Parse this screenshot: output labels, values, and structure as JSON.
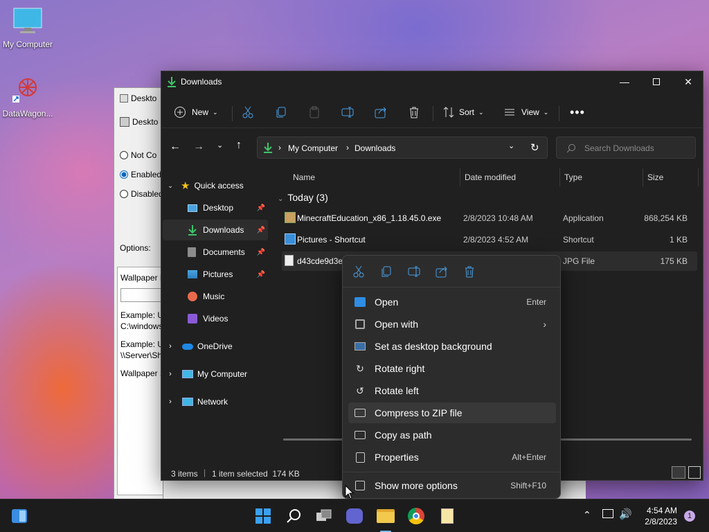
{
  "desktop": {
    "icons": [
      {
        "label": "My Computer"
      },
      {
        "label": "DataWagon..."
      }
    ]
  },
  "background_window": {
    "title": "Deskto",
    "header": "Deskto",
    "radio_not": "Not Co",
    "radio_enabled": "Enabled",
    "radio_disabled": "Disabled",
    "options_label": "Options:",
    "field_label": "Wallpaper N",
    "example1a": "Example: U",
    "example1b": "C:\\windows",
    "example2a": "Example: U",
    "example2b": "\\\\Server\\Sh",
    "style_label": "Wallpaper S"
  },
  "explorer": {
    "title": "Downloads",
    "toolbar": {
      "new_label": "New",
      "sort_label": "Sort",
      "view_label": "View"
    },
    "address": {
      "segments": [
        "My Computer",
        "Downloads"
      ]
    },
    "search": {
      "placeholder": "Search Downloads"
    },
    "nav": {
      "quick_access": "Quick access",
      "items": [
        {
          "label": "Desktop"
        },
        {
          "label": "Downloads"
        },
        {
          "label": "Documents"
        },
        {
          "label": "Pictures"
        },
        {
          "label": "Music"
        },
        {
          "label": "Videos"
        }
      ],
      "onedrive": "OneDrive",
      "my_computer": "My Computer",
      "network": "Network"
    },
    "columns": {
      "name": "Name",
      "date": "Date modified",
      "type": "Type",
      "size": "Size"
    },
    "group_label": "Today (3)",
    "files": [
      {
        "name": "MinecraftEducation_x86_1.18.45.0.exe",
        "date": "2/8/2023 10:48 AM",
        "type": "Application",
        "size": "868,254 KB"
      },
      {
        "name": "Pictures - Shortcut",
        "date": "2/8/2023 4:52 AM",
        "type": "Shortcut",
        "size": "1 KB"
      },
      {
        "name": "d43cde9d3e",
        "date": "",
        "type": "JPG File",
        "size": "175 KB"
      }
    ],
    "status": {
      "items": "3 items",
      "selected": "1 item selected  174 KB"
    }
  },
  "context_menu": {
    "items": [
      {
        "label": "Open",
        "accel": "Enter"
      },
      {
        "label": "Open with",
        "accel": ""
      },
      {
        "label": "Set as desktop background",
        "accel": ""
      },
      {
        "label": "Rotate right",
        "accel": ""
      },
      {
        "label": "Rotate left",
        "accel": ""
      },
      {
        "label": "Compress to ZIP file",
        "accel": ""
      },
      {
        "label": "Copy as path",
        "accel": ""
      },
      {
        "label": "Properties",
        "accel": "Alt+Enter"
      }
    ],
    "more": {
      "label": "Show more options",
      "accel": "Shift+F10"
    }
  },
  "taskbar": {
    "time": "4:54 AM",
    "date": "2/8/2023",
    "notification_count": "1"
  },
  "colors": {
    "accent": "#0067c0",
    "explorer_bg": "#202020",
    "menu_bg": "#2c2c2c",
    "taskbar_bg": "#1c1c1c"
  }
}
